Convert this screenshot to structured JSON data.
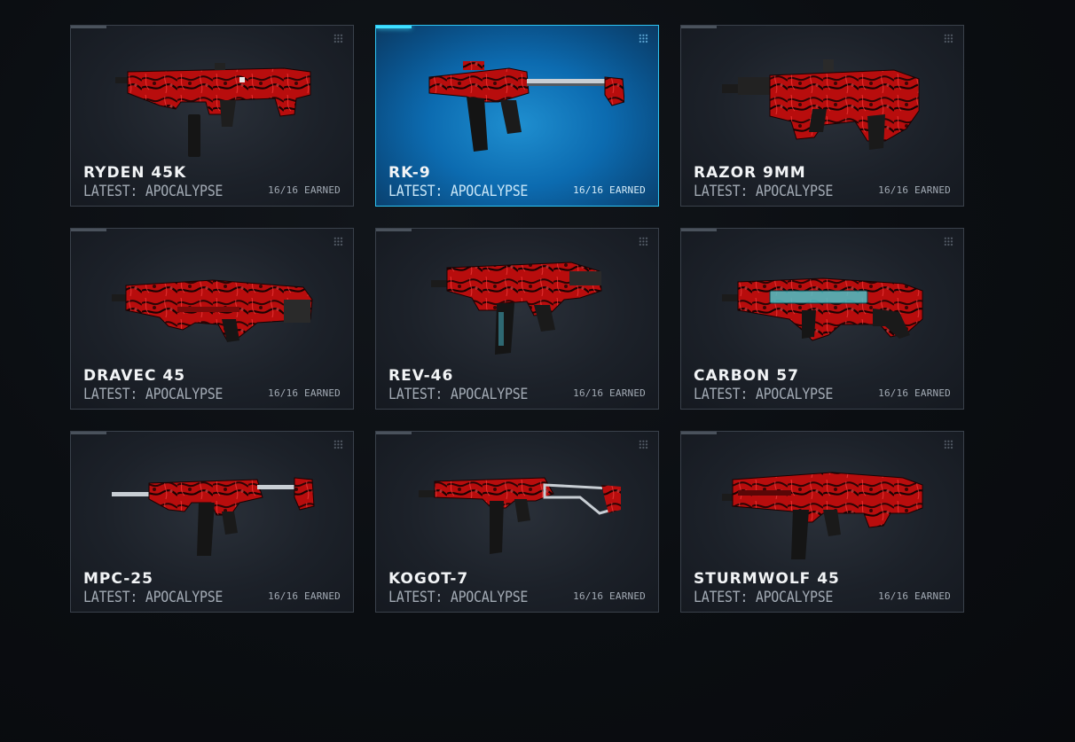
{
  "colors": {
    "card_border": "#3a414b",
    "selected_border": "#2fc4f2",
    "selected_fill": "#0c6bb0",
    "camo_red": "#d01212"
  },
  "weapons": [
    {
      "name": "RYDEN 45K",
      "latest": "LATEST: APOCALYPSE",
      "earned": "16/16 EARNED",
      "selected": false
    },
    {
      "name": "RK-9",
      "latest": "LATEST: APOCALYPSE",
      "earned": "16/16 EARNED",
      "selected": true
    },
    {
      "name": "RAZOR 9MM",
      "latest": "LATEST: APOCALYPSE",
      "earned": "16/16 EARNED",
      "selected": false
    },
    {
      "name": "DRAVEC 45",
      "latest": "LATEST: APOCALYPSE",
      "earned": "16/16 EARNED",
      "selected": false
    },
    {
      "name": "REV-46",
      "latest": "LATEST: APOCALYPSE",
      "earned": "16/16 EARNED",
      "selected": false
    },
    {
      "name": "CARBON 57",
      "latest": "LATEST: APOCALYPSE",
      "earned": "16/16 EARNED",
      "selected": false
    },
    {
      "name": "MPC-25",
      "latest": "LATEST: APOCALYPSE",
      "earned": "16/16 EARNED",
      "selected": false
    },
    {
      "name": "KOGOT-7",
      "latest": "LATEST: APOCALYPSE",
      "earned": "16/16 EARNED",
      "selected": false
    },
    {
      "name": "STURMWOLF 45",
      "latest": "LATEST: APOCALYPSE",
      "earned": "16/16 EARNED",
      "selected": false
    }
  ]
}
